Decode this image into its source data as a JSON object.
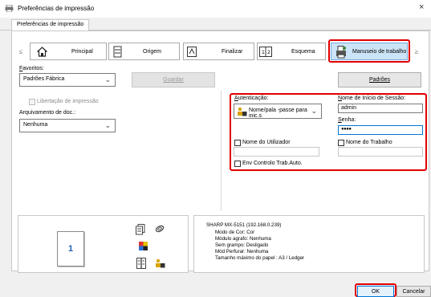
{
  "window": {
    "title": "Preferências de impressão",
    "close": "×"
  },
  "tabs": [
    "Preferências de impressão"
  ],
  "nav": {
    "left_arrow": "≤",
    "right_arrow": "≥",
    "items": [
      "Principal",
      "Origem",
      "Finalizar",
      "Esquema",
      "Manuseio de trabalho"
    ]
  },
  "favorites": {
    "label": "Favoritos:",
    "value": "Padrões Fábrica",
    "save": "Guardar",
    "defaults": "Padrões"
  },
  "left": {
    "retention_label": "Libertação de impressão",
    "archive_label": "Arquivamento de doc.:",
    "archive_value": "Nenhuma"
  },
  "auth": {
    "label": "Autenticação:",
    "value": "Nome/pala -passe para inic.s",
    "login_label": "Nome de Início de Sessão:",
    "login_value": "admin",
    "password_label": "Senha:",
    "password_value": "●●●●",
    "user_name_label": "Nome do Utilizador",
    "job_name_label": "Nome do Trabalho",
    "job_control_label": "Env Controlo Trab.Auto."
  },
  "preview": {
    "page_number": "1"
  },
  "info": {
    "model": "SHARP MX-5151 (192.168.0.239)",
    "lines": [
      "Modo de Cor: Cor",
      "Módulo agrafo: Nenhuma",
      "Sem grampo: Desligado",
      "Mód Perfurar: Nenhuma",
      "Tamanho máximo do papel : A3 / Ledger"
    ]
  },
  "footer": {
    "ok": "OK",
    "cancel": "Cancelar"
  }
}
